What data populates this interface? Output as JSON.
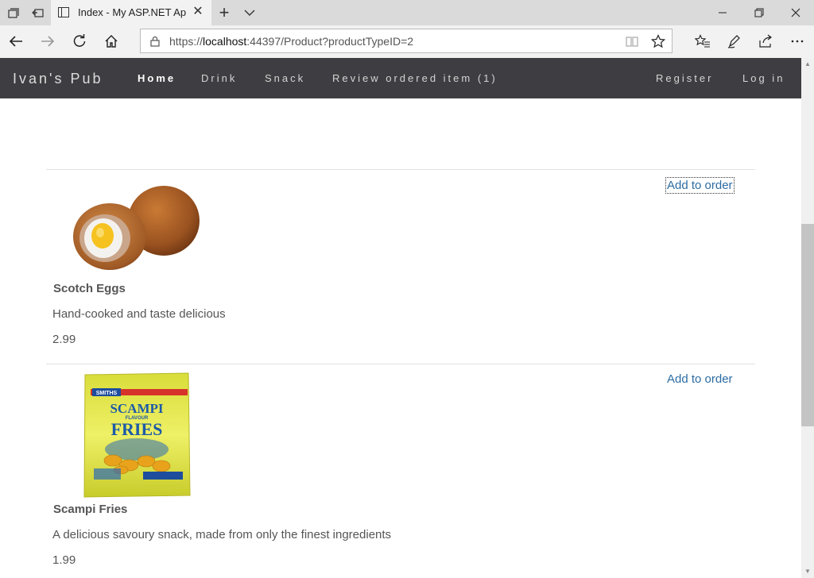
{
  "browser": {
    "tab_title": "Index - My ASP.NET Ap",
    "tab_close": "✕",
    "new_tab": "+",
    "url_scheme_prefix": "https://",
    "url_host": "localhost",
    "url_rest": ":44397/Product?productTypeID=2"
  },
  "site": {
    "brand": "Ivan's Pub",
    "nav": [
      "Home",
      "Drink",
      "Snack",
      "Review ordered item (1)"
    ],
    "nav_right": [
      "Register",
      "Log in"
    ]
  },
  "products": [
    {
      "name": "Scotch Eggs",
      "description": "Hand-cooked and taste delicious",
      "price": "2.99",
      "action": "Add to order",
      "image": "scotch-eggs-image"
    },
    {
      "name": "Scampi Fries",
      "description": "A delicious savoury snack, made from only the finest ingredients",
      "price": "1.99",
      "action": "Add to order",
      "image": "scampi-fries-image",
      "packet": {
        "brand": "SMITHS",
        "line1": "SCAMPI",
        "line2": "FLAVOUR",
        "line3": "FRIES"
      }
    }
  ],
  "colors": {
    "navbar": "#3e3e42",
    "link": "#2d6ca2",
    "text": "#555555"
  }
}
